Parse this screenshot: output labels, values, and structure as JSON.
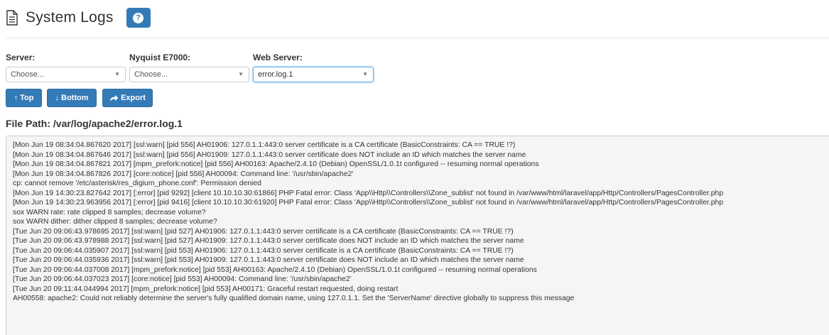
{
  "header": {
    "title": "System Logs",
    "help_label": "?",
    "icon": "document-icon"
  },
  "filters": {
    "server": {
      "label": "Server:",
      "value": "Choose..."
    },
    "nyquist": {
      "label": "Nyquist E7000:",
      "value": "Choose..."
    },
    "web_server": {
      "label": "Web Server:",
      "value": "error.log.1"
    }
  },
  "toolbar": {
    "top_label": "Top",
    "top_icon": "↑",
    "bottom_label": "Bottom",
    "bottom_icon": "↓",
    "export_label": "Export",
    "export_icon": "share-icon"
  },
  "file_path": "File Path: /var/log/apache2/error.log.1",
  "log_lines": [
    "[Mon Jun 19 08:34:04.867620 2017] [ssl:warn] [pid 556] AH01906: 127.0.1.1:443:0 server certificate is a CA certificate (BasicConstraints: CA == TRUE !?)",
    "[Mon Jun 19 08:34:04.867646 2017] [ssl:warn] [pid 556] AH01909: 127.0.1.1:443:0 server certificate does NOT include an ID which matches the server name",
    "[Mon Jun 19 08:34:04.867821 2017] [mpm_prefork:notice] [pid 556] AH00163: Apache/2.4.10 (Debian) OpenSSL/1.0.1t configured -- resuming normal operations",
    "[Mon Jun 19 08:34:04.867826 2017] [core:notice] [pid 556] AH00094: Command line: '/usr/sbin/apache2'",
    "cp: cannot remove '/etc/asterisk/res_digium_phone.conf': Permission denied",
    "[Mon Jun 19 14:30:23.827642 2017] [:error] [pid 9292] [client 10.10.10.30:61866] PHP Fatal error:  Class 'App\\\\Http\\\\Controllers\\\\Zone_sublist' not found in /var/www/html/laravel/app/Http/Controllers/PagesController.php",
    "[Mon Jun 19 14:30:23.963956 2017] [:error] [pid 9416] [client 10.10.10.30:61920] PHP Fatal error:  Class 'App\\\\Http\\\\Controllers\\\\Zone_sublist' not found in /var/www/html/laravel/app/Http/Controllers/PagesController.php",
    "sox WARN rate: rate clipped 8 samples; decrease volume?",
    "sox WARN dither: dither clipped 8 samples; decrease volume?",
    "[Tue Jun 20 09:06:43.978695 2017] [ssl:warn] [pid 527] AH01906: 127.0.1.1:443:0 server certificate is a CA certificate (BasicConstraints: CA == TRUE !?)",
    "[Tue Jun 20 09:06:43.978988 2017] [ssl:warn] [pid 527] AH01909: 127.0.1.1:443:0 server certificate does NOT include an ID which matches the server name",
    "[Tue Jun 20 09:06:44.035907 2017] [ssl:warn] [pid 553] AH01906: 127.0.1.1:443:0 server certificate is a CA certificate (BasicConstraints: CA == TRUE !?)",
    "[Tue Jun 20 09:06:44.035936 2017] [ssl:warn] [pid 553] AH01909: 127.0.1.1:443:0 server certificate does NOT include an ID which matches the server name",
    "[Tue Jun 20 09:06:44.037008 2017] [mpm_prefork:notice] [pid 553] AH00163: Apache/2.4.10 (Debian) OpenSSL/1.0.1t configured -- resuming normal operations",
    "[Tue Jun 20 09:06:44.037023 2017] [core:notice] [pid 553] AH00094: Command line: '/usr/sbin/apache2'",
    "[Tue Jun 20 09:11:44.044994 2017] [mpm_prefork:notice] [pid 553] AH00171: Graceful restart requested, doing restart",
    "AH00558: apache2: Could not reliably determine the server's fully qualified domain name, using 127.0.1.1. Set the 'ServerName' directive globally to suppress this message"
  ],
  "colors": {
    "primary": "#337ab7",
    "log_background": "#f5f5f5",
    "focus_border": "#66afe9"
  }
}
